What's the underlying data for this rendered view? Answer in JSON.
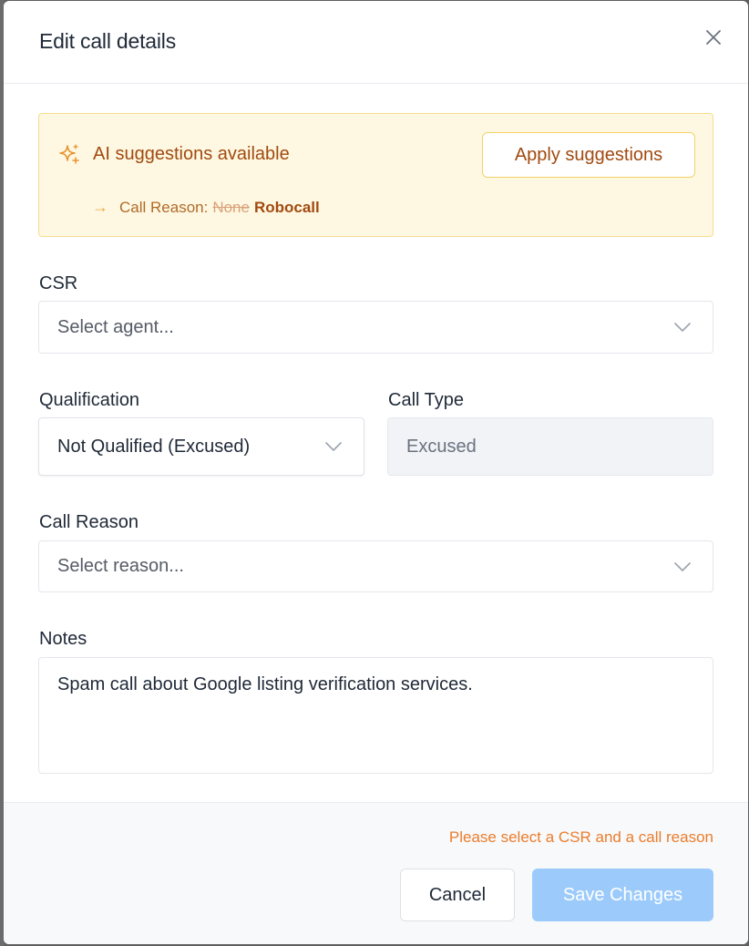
{
  "modal": {
    "title": "Edit call details"
  },
  "ai_suggestions": {
    "title": "AI suggestions available",
    "apply_label": "Apply suggestions",
    "row_label": "Call Reason:",
    "old_value": "None",
    "new_value": "Robocall",
    "arrow": "→"
  },
  "form": {
    "csr": {
      "label": "CSR",
      "placeholder": "Select agent..."
    },
    "qualification": {
      "label": "Qualification",
      "value": "Not Qualified (Excused)"
    },
    "call_type": {
      "label": "Call Type",
      "value": "Excused"
    },
    "call_reason": {
      "label": "Call Reason",
      "placeholder": "Select reason..."
    },
    "notes": {
      "label": "Notes",
      "value": "Spam call about Google listing verification services."
    }
  },
  "footer": {
    "error": "Please select a CSR and a call reason",
    "cancel_label": "Cancel",
    "save_label": "Save Changes"
  },
  "icons": {
    "close": "close-icon",
    "sparkle": "sparkle-icon",
    "chevron": "chevron-down-icon"
  },
  "colors": {
    "accent_text": "#a14a10",
    "warning_bg": "#fef8e2",
    "error_text": "#ea7d2d",
    "save_disabled": "#9ccbfb"
  }
}
